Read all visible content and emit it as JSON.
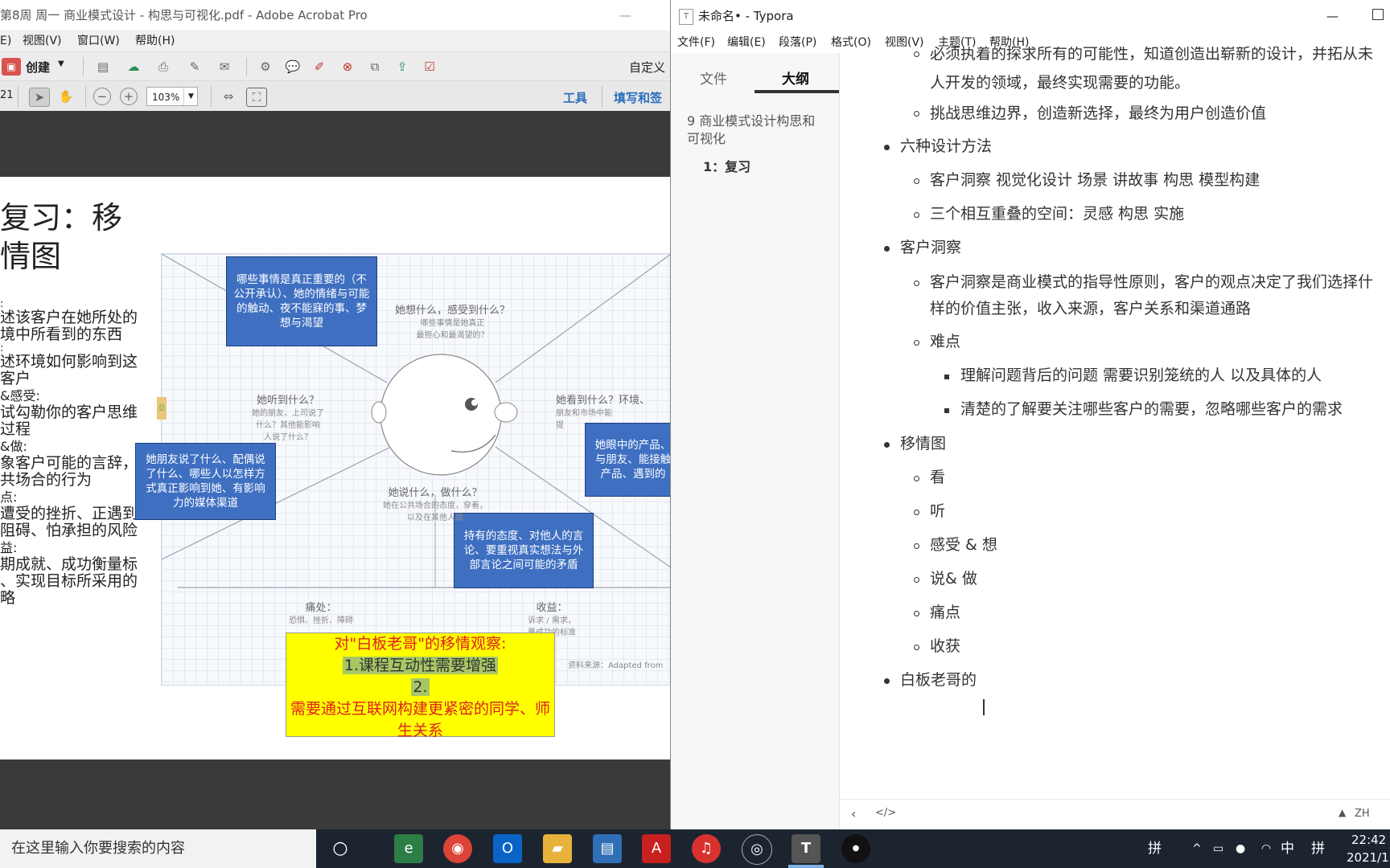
{
  "acrobat": {
    "title": "第8周 周一 商业模式设计 - 构思与可视化.pdf - Adobe Acrobat Pro",
    "menu": [
      "E)",
      "视图(V)",
      "窗口(W)",
      "帮助(H)"
    ],
    "create_label": "创建",
    "customize_label": "自定义",
    "page_number": "21",
    "zoom_value": "103%",
    "tools_label": "工具",
    "fill_sign_label": "填写和签",
    "slide": {
      "title_line1": "复习：移",
      "title_line2": "情图",
      "left_lines": [
        ":",
        "述该客户在她所处的",
        "境中所看到的东西",
        ":",
        "述环境如何影响到这",
        "客户",
        "&感受:",
        "试勾勒你的客户思维",
        "过程",
        "&做:",
        "象客户可能的言辞，或",
        "共场合的行为",
        "点:",
        "遭受的挫折、正遇到",
        "阻碍、怕承担的风险",
        "益:",
        "期成就、成功衡量标",
        "、实现目标所采用的",
        "略"
      ],
      "box_top": "哪些事情是真正重要的（不公开承认）、她的情绪与可能的触动、夜不能寐的事、梦想与渴望",
      "box_left": "她朋友说了什么、配偶说了什么、哪些人以怎样方式真正影响到她、有影响力的媒体渠道",
      "box_right": "她眼中的产品、与朋友、能接触产品、遇到的",
      "box_bottom": "持有的态度、对他人的言论、要重视真实想法与外部言论之间可能的矛盾",
      "think_head": "她想什么，感受到什么？",
      "think_sub1": "哪些事情是她真正",
      "think_sub2": "最担心和最渴望的？",
      "hear_head": "她听到什么？",
      "hear_sub1": "她的朋友、上司说了",
      "hear_sub2": "什么？其他能影响",
      "hear_sub3": "人说了什么？",
      "see_head": "她看到什么？环境、",
      "see_sub1": "朋友和市场中能",
      "see_sub2": "提",
      "say_head": "她说什么，做什么？",
      "say_sub1": "她在公共场合的态度，穿着，",
      "say_sub2": "以及在其他人面",
      "pain_head": "痛处：",
      "pain_sub": "恐惧、挫折、障碍",
      "gain_head": "收益：",
      "gain_sub1": "诉求 / 需求，",
      "gain_sub2": "量成功的标准",
      "source": "资料来源：Adapted from",
      "marker": "0",
      "yellow_line1": "对\"白板老哥\"的移情观察:",
      "yellow_line2": "1.课程互动性需要增强",
      "yellow_line3": "2.",
      "yellow_line4": "需要通过互联网构建更紧密的同学、师",
      "yellow_line5": "生关系"
    }
  },
  "typora": {
    "title": "未命名• - Typora",
    "menu": [
      "文件(F)",
      "编辑(E)",
      "段落(P)",
      "格式(O)",
      "视图(V)",
      "主题(T)",
      "帮助(H)"
    ],
    "tabs": [
      "文件",
      "大纲"
    ],
    "outline": [
      "9 商业模式设计构思和可视化",
      "1：复习"
    ],
    "content": {
      "l0a": "必须执着的探求所有的可能性，知道创造出崭新的设计，并拓从未",
      "l0b": "人开发的领域，最终实现需要的功能。",
      "l1": "挑战思维边界，创造新选择，最终为用户创造价值",
      "l2": "六种设计方法",
      "l3": "客户洞察 视觉化设计  场景 讲故事  构思 模型构建",
      "l4": "三个相互重叠的空间：灵感  构思 实施",
      "l5": "客户洞察",
      "l6a": "客户洞察是商业模式的指导性原则，客户的观点决定了我们选择什",
      "l6b": "样的价值主张，收入来源，客户关系和渠道通路",
      "l7": "难点",
      "l8": "理解问题背后的问题 需要识别笼统的人  以及具体的人",
      "l9": "清楚的了解要关注哪些客户的需要，忽略哪些客户的需求",
      "l10": "移情图",
      "l11": "看",
      "l12": "听",
      "l13": "感受 & 想",
      "l14": "说& 做",
      "l15": "痛点",
      "l16": "收获",
      "l17": "白板老哥的"
    },
    "status_lang": "ZH"
  },
  "taskbar": {
    "search_placeholder": "在这里输入你要搜索的内容",
    "ime1": "拼",
    "ime2": "中",
    "ime3": "拼",
    "time": "22:42",
    "date": "2021/1"
  }
}
